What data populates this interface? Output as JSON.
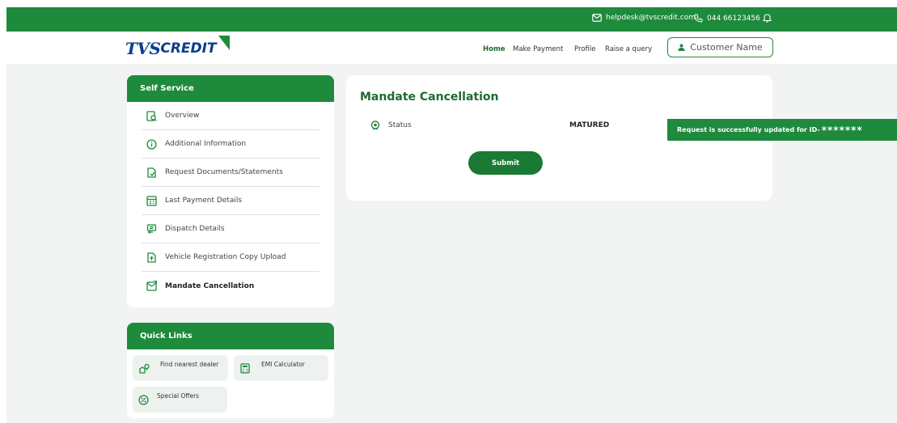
{
  "topbar": {
    "email": "helpdesk@tvscredit.com",
    "phone": "044 66123456"
  },
  "header": {
    "logo_primary": "TVS",
    "logo_secondary": "CREDIT",
    "nav": [
      "Home",
      "Make Payment",
      "Profile",
      "Raise a query"
    ],
    "customer_button": "Customer Name"
  },
  "sidebar": {
    "title": "Self Service",
    "items": [
      {
        "label": "Overview",
        "icon": "overview-icon"
      },
      {
        "label": "Additional Information",
        "icon": "info-icon"
      },
      {
        "label": "Request Documents/Statements",
        "icon": "document-request-icon"
      },
      {
        "label": "Last Payment Details",
        "icon": "payment-icon"
      },
      {
        "label": "Dispatch Details",
        "icon": "dispatch-icon"
      },
      {
        "label": "Vehicle Registration Copy Upload",
        "icon": "upload-icon"
      },
      {
        "label": "Mandate Cancellation",
        "icon": "mandate-icon"
      }
    ]
  },
  "quicklinks": {
    "title": "Quick Links",
    "items": [
      {
        "label": "Find nearest dealer",
        "icon": "dealer-icon"
      },
      {
        "label": "EMI Calculator",
        "icon": "calculator-icon"
      },
      {
        "label": "Special Offers",
        "icon": "offers-icon"
      }
    ]
  },
  "main": {
    "title": "Mandate Cancellation",
    "status_label": "Status",
    "status_value": "MATURED",
    "submit_label": "Submit"
  },
  "toast": {
    "message": "Request is successfully updated for ID-",
    "masked_id": "*******"
  },
  "colors": {
    "brand_green": "#1e8a3c",
    "logo_blue": "#0b3d8c",
    "page_bg": "#f2f4f3"
  }
}
